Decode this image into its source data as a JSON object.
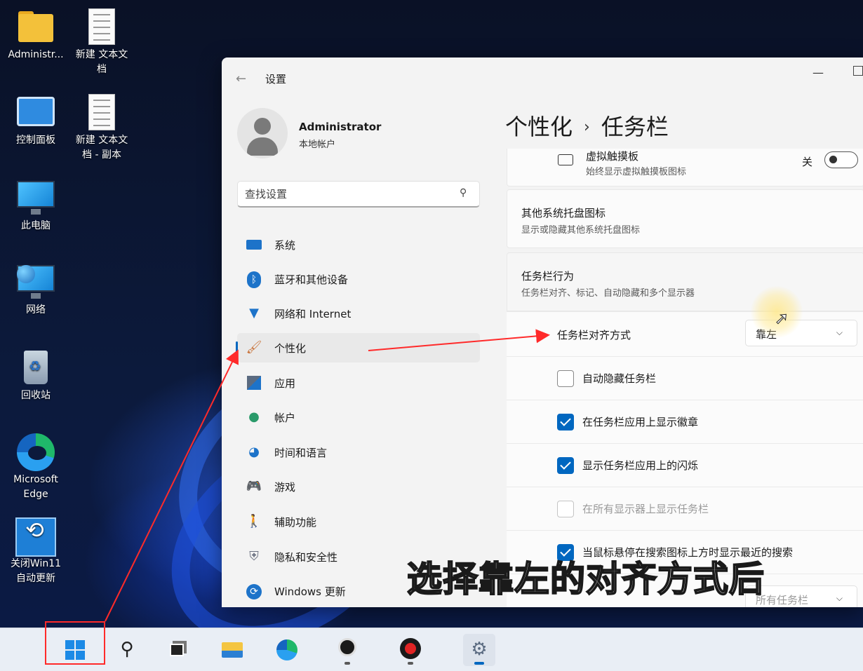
{
  "desktop": {
    "icons": [
      {
        "label": "Administr..."
      },
      {
        "label": "新建 文本文档"
      },
      {
        "label": "控制面板"
      },
      {
        "label": "新建 文本文档 - 副本"
      },
      {
        "label": "此电脑"
      },
      {
        "label": "网络"
      },
      {
        "label": "回收站"
      },
      {
        "label": "Microsoft Edge"
      },
      {
        "label": "关闭Win11自动更新"
      }
    ]
  },
  "window": {
    "title": "设置",
    "minimize_glyph": "—"
  },
  "user": {
    "name": "Administrator",
    "account_type": "本地帐户"
  },
  "search": {
    "placeholder": "查找设置"
  },
  "nav": {
    "items": [
      {
        "label": "系统",
        "icon": "monitor-icon"
      },
      {
        "label": "蓝牙和其他设备",
        "icon": "bluetooth-icon"
      },
      {
        "label": "网络和 Internet",
        "icon": "wifi-icon"
      },
      {
        "label": "个性化",
        "icon": "brush-icon",
        "selected": true
      },
      {
        "label": "应用",
        "icon": "apps-icon"
      },
      {
        "label": "帐户",
        "icon": "person-icon"
      },
      {
        "label": "时间和语言",
        "icon": "globe-clock-icon"
      },
      {
        "label": "游戏",
        "icon": "gamepad-icon"
      },
      {
        "label": "辅助功能",
        "icon": "accessibility-icon"
      },
      {
        "label": "隐私和安全性",
        "icon": "shield-icon"
      },
      {
        "label": "Windows 更新",
        "icon": "update-icon"
      }
    ]
  },
  "page": {
    "breadcrumb_parent": "个性化",
    "breadcrumb_sep": "›",
    "breadcrumb_current": "任务栏"
  },
  "touchpad": {
    "title": "虚拟触摸板",
    "subtitle": "始终显示虚拟触摸板图标",
    "toggle_state": "关"
  },
  "tray": {
    "title": "其他系统托盘图标",
    "subtitle": "显示或隐藏其他系统托盘图标"
  },
  "behaviors": {
    "title": "任务栏行为",
    "subtitle": "任务栏对齐、标记、自动隐藏和多个显示器",
    "alignment_label": "任务栏对齐方式",
    "alignment_value": "靠左",
    "options": [
      {
        "label": "自动隐藏任务栏",
        "checked": false,
        "disabled": false
      },
      {
        "label": "在任务栏应用上显示徽章",
        "checked": true,
        "disabled": false
      },
      {
        "label": "显示任务栏应用上的闪烁",
        "checked": true,
        "disabled": false
      },
      {
        "label": "在所有显示器上显示任务栏",
        "checked": false,
        "disabled": true
      },
      {
        "label": "当鼠标悬停在搜索图标上方时显示最近的搜索",
        "checked": true,
        "disabled": false
      }
    ],
    "partial_row_value": "所有任务栏"
  },
  "caption": "选择靠左的对齐方式后",
  "colors": {
    "accent": "#0067c0",
    "annotation": "#ff2a2a"
  }
}
